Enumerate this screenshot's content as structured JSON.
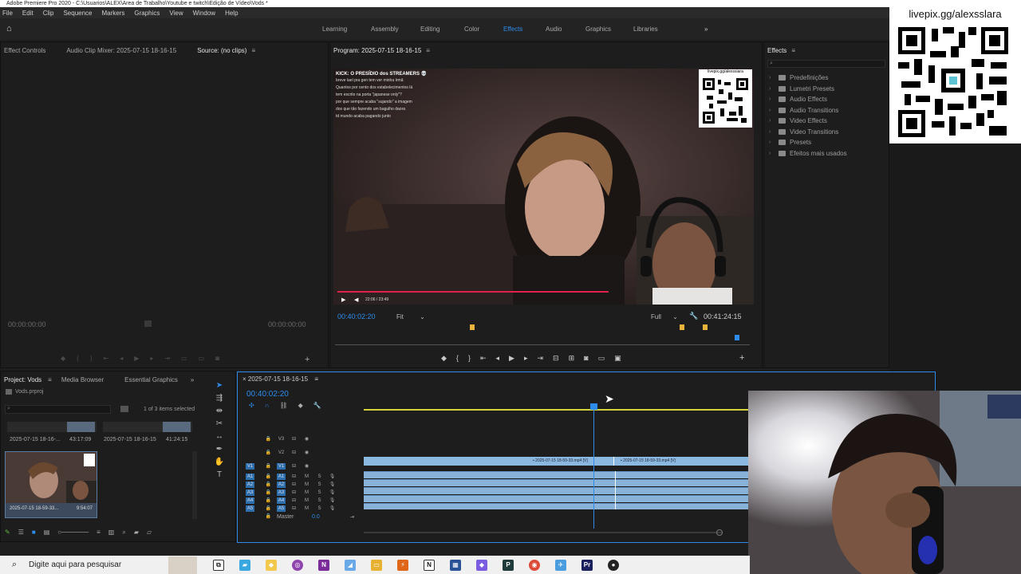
{
  "window_title": "Adobe Premiere Pro 2020 - C:\\Usuarios\\ALEX\\Area de Trabalho\\Youtube e twitch\\Edição de Vídeo\\Vods *",
  "menu": [
    "File",
    "Edit",
    "Clip",
    "Sequence",
    "Markers",
    "Graphics",
    "View",
    "Window",
    "Help"
  ],
  "workspaces": [
    "Learning",
    "Assembly",
    "Editing",
    "Color",
    "Effects",
    "Audio",
    "Graphics",
    "Libraries"
  ],
  "active_workspace": "Effects",
  "source_panel": {
    "tabs": [
      "Effect Controls",
      "Audio Clip Mixer: 2025-07-15 18-16-15",
      "Source: (no clips)"
    ],
    "timecode_left": "00:00:00:00",
    "timecode_right": "00:00:00:00"
  },
  "program_panel": {
    "tab": "Program: 2025-07-15 18-16-15",
    "timecode": "00:40:02:20",
    "fit": "Fit",
    "quality": "Full",
    "duration": "00:41:24:15"
  },
  "video_overlay": {
    "chat_title": "KICK: O PRESÍDIO dos STREAMERS 💀",
    "chat_lines": [
      "breve lael pra gen tem ver minha Irmã",
      "Quantos por cento dos estabelecimentos lá",
      "tem escrito na porta \"japanese only\"?",
      "por que sempre acaba \"sujando\" a imagem",
      "dos que tão fazendo um bagulho daora",
      "td mundo acaba pagando junto"
    ],
    "qr_caption": "livepix.gg/alexssiara",
    "player_time": "22:06 / 23:49"
  },
  "effects_panel": {
    "tab": "Effects",
    "items": [
      "Predefinições",
      "Lumetri Presets",
      "Audio Effects",
      "Audio Transitions",
      "Video Effects",
      "Video Transitions",
      "Presets",
      "Efeitos mais usados"
    ]
  },
  "overlay_qr": {
    "url": "livepix.gg/alexsslara"
  },
  "project_panel": {
    "tabs": [
      "Project: Vods",
      "Media Browser",
      "Essential Graphics"
    ],
    "file": "Vods.prproj",
    "selection": "1 of 3 items selected",
    "items": [
      {
        "name": "2025-07-15 18-16-...",
        "duration": "43:17:09"
      },
      {
        "name": "2025-07-15 18-16-15",
        "duration": "41:24:15"
      },
      {
        "name": "2025-07-15 18-59-33...",
        "duration": "9:54:07"
      }
    ]
  },
  "timeline": {
    "sequence_tab": "2025-07-15 18-16-15",
    "timecode": "00:40:02:20",
    "video_tracks": [
      "V3",
      "V2",
      "V1"
    ],
    "audio_tracks": [
      "A1",
      "A2",
      "A3",
      "A4",
      "A5"
    ],
    "master_label": "Master",
    "master_value": "0.0",
    "clip1": "2025-07-15 18-59-33.mp4 [V]",
    "clip2": "2025-07-15 18-59-33.mp4 [V]"
  },
  "taskbar": {
    "search_placeholder": "Digite aqui para pesquisar"
  }
}
